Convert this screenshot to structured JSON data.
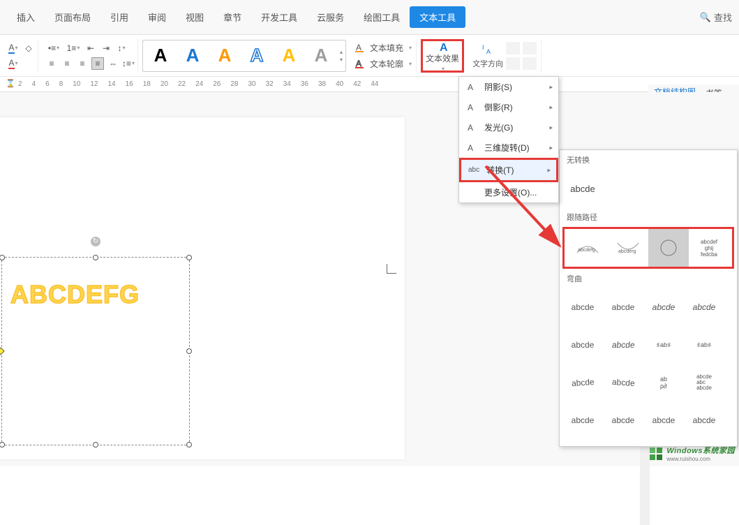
{
  "menubar": {
    "tabs": [
      "插入",
      "页面布局",
      "引用",
      "审阅",
      "视图",
      "章节",
      "开发工具",
      "云服务",
      "绘图工具",
      "文本工具"
    ],
    "active_index": 9,
    "search_label": "查找"
  },
  "toolbar": {
    "style_letters": [
      "A",
      "A",
      "A",
      "A",
      "A",
      "A"
    ],
    "text_fill": "文本填充",
    "text_outline": "文本轮廓",
    "text_effect": "文本效果",
    "text_direction_label": "文字方向"
  },
  "ruler": {
    "ticks": [
      "2",
      "4",
      "6",
      "8",
      "10",
      "12",
      "14",
      "16",
      "18",
      "20",
      "22",
      "24",
      "26",
      "28",
      "30",
      "32",
      "34",
      "36",
      "38",
      "40",
      "42",
      "44"
    ]
  },
  "artwork": {
    "text": "ABCDEFG"
  },
  "dropdown": {
    "shadow": "阴影(S)",
    "reflection": "倒影(R)",
    "glow": "发光(G)",
    "rotate3d": "三维旋转(D)",
    "transform": "转换(T)",
    "transform_icon": "abc",
    "more": "更多设置(O)..."
  },
  "submenu": {
    "no_transform": "无转换",
    "plain_sample": "abcde",
    "follow_path": "跟随路径",
    "warp": "弯曲",
    "sample": "abcde",
    "ghij": "ghij"
  },
  "sidepanel": {
    "structure": "文档结构图",
    "bookmark": "书签"
  },
  "watermark": {
    "main": "Windows系统家园",
    "sub": "www.ruishou.com"
  }
}
